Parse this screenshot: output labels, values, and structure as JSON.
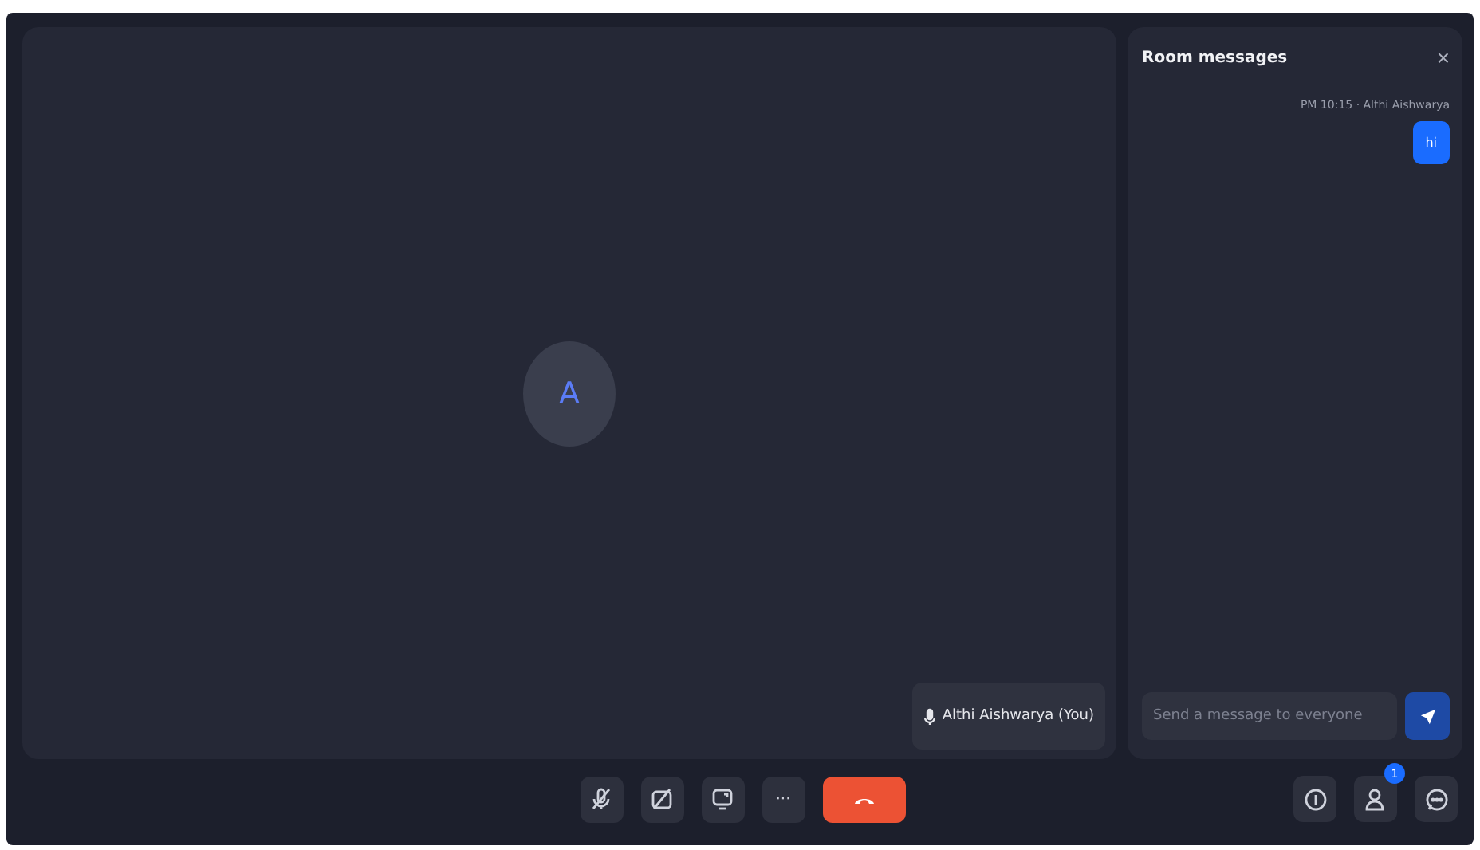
{
  "stage": {
    "avatar": "A",
    "name_tag": {
      "label": "Althi Aishwarya (You)"
    }
  },
  "chat": {
    "title": "Room messages",
    "close": "×",
    "messages": [
      {
        "meta": "PM 10:15 · Althi Aishwarya",
        "text": "hi"
      }
    ],
    "input": {
      "placeholder": "Send a message to everyone"
    }
  },
  "controls": [
    {
      "kind": "mic",
      "off": true
    },
    {
      "kind": "camera",
      "off": true
    },
    {
      "kind": "share",
      "off": false
    },
    {
      "kind": "more",
      "label": "···"
    },
    {
      "kind": "hangup"
    }
  ],
  "side_controls": [
    {
      "kind": "info"
    },
    {
      "kind": "people",
      "badge": "1"
    },
    {
      "kind": "chat"
    }
  ]
}
